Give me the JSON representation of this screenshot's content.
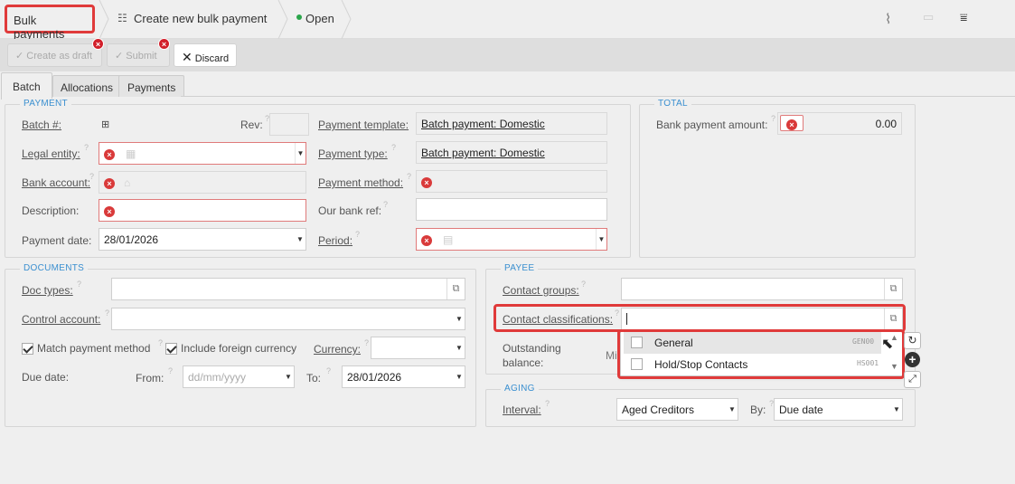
{
  "header": {
    "breadcrumb_root": "Bulk payments",
    "breadcrumb_page": "Create new bulk payment",
    "status": "Open",
    "status_color": "#2aa54a"
  },
  "toolbar": {
    "create_draft": "Create as draft",
    "submit": "Submit",
    "discard": "Discard"
  },
  "tabs": [
    "Batch",
    "Allocations",
    "Payments"
  ],
  "payment": {
    "title": "PAYMENT",
    "batch_label": "Batch #:",
    "rev_label": "Rev:",
    "legal_entity_label": "Legal entity:",
    "bank_account_label": "Bank account:",
    "description_label": "Description:",
    "payment_date_label": "Payment date:",
    "payment_date_value": "28/01/2026",
    "payment_template_label": "Payment template:",
    "payment_template_value": "Batch payment: Domestic",
    "payment_type_label": "Payment type:",
    "payment_type_value": "Batch payment: Domestic",
    "payment_method_label": "Payment method:",
    "our_bank_ref_label": "Our bank ref:",
    "period_label": "Period:"
  },
  "total": {
    "title": "TOTAL",
    "bank_payment_amount_label": "Bank payment amount:",
    "bank_payment_amount_value": "0.00"
  },
  "documents": {
    "title": "DOCUMENTS",
    "doc_types_label": "Doc types:",
    "control_account_label": "Control account:",
    "match_payment_method": "Match payment method",
    "include_foreign_currency": "Include foreign currency",
    "currency_label": "Currency:",
    "due_date_label": "Due date:",
    "from_label": "From:",
    "from_placeholder": "dd/mm/yyyy",
    "to_label": "To:",
    "to_value": "28/01/2026"
  },
  "payee": {
    "title": "PAYEE",
    "contact_groups_label": "Contact groups:",
    "contact_classifications_label": "Contact classifications:",
    "outstanding_balance_label_1": "Outstanding",
    "outstanding_balance_label_2": "balance:",
    "outstanding_partial": "Mi",
    "dropdown": [
      {
        "label": "General",
        "code": "GEN00"
      },
      {
        "label": "Hold/Stop Contacts",
        "code": "HS001"
      }
    ]
  },
  "aging": {
    "title": "AGING",
    "interval_label": "Interval:",
    "interval_value": "Aged Creditors",
    "by_label": "By:",
    "by_value": "Due date"
  }
}
